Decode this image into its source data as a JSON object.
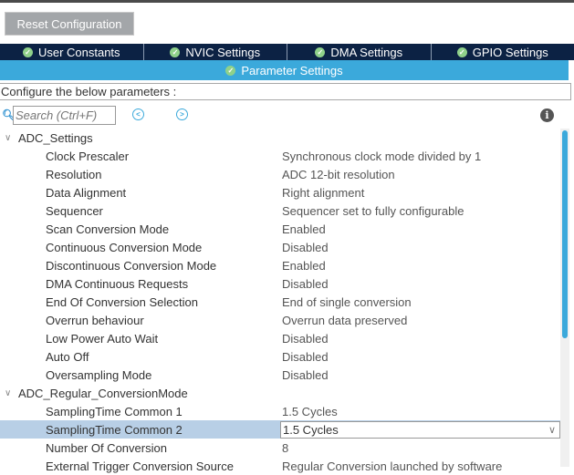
{
  "toolbar": {
    "reset_label": "Reset Configuration"
  },
  "tabs": [
    {
      "label": "User Constants"
    },
    {
      "label": "NVIC Settings"
    },
    {
      "label": "DMA Settings"
    },
    {
      "label": "GPIO Settings"
    }
  ],
  "active_tab": {
    "label": "Parameter Settings"
  },
  "configure_text": "Configure the below parameters :",
  "search": {
    "placeholder": "Search (Ctrl+F)"
  },
  "groups": [
    {
      "label": "ADC_Settings",
      "items": [
        {
          "label": "Clock Prescaler",
          "value": "Synchronous clock mode divided by 1"
        },
        {
          "label": "Resolution",
          "value": "ADC 12-bit resolution"
        },
        {
          "label": "Data Alignment",
          "value": "Right alignment"
        },
        {
          "label": "Sequencer",
          "value": "Sequencer set to fully configurable"
        },
        {
          "label": "Scan Conversion Mode",
          "value": "Enabled"
        },
        {
          "label": "Continuous Conversion Mode",
          "value": "Disabled"
        },
        {
          "label": "Discontinuous Conversion Mode",
          "value": "Enabled"
        },
        {
          "label": "DMA Continuous Requests",
          "value": "Disabled"
        },
        {
          "label": "End Of Conversion Selection",
          "value": "End of single conversion"
        },
        {
          "label": "Overrun behaviour",
          "value": "Overrun data preserved"
        },
        {
          "label": "Low Power Auto Wait",
          "value": "Disabled"
        },
        {
          "label": "Auto Off",
          "value": "Disabled"
        },
        {
          "label": "Oversampling Mode",
          "value": "Disabled"
        }
      ]
    },
    {
      "label": "ADC_Regular_ConversionMode",
      "items": [
        {
          "label": "SamplingTime Common 1",
          "value": "1.5 Cycles"
        },
        {
          "label": "SamplingTime Common 2",
          "value": "1.5 Cycles"
        },
        {
          "label": "Number Of Conversion",
          "value": "8"
        },
        {
          "label": "External Trigger Conversion Source",
          "value": "Regular Conversion launched by software"
        }
      ]
    }
  ]
}
